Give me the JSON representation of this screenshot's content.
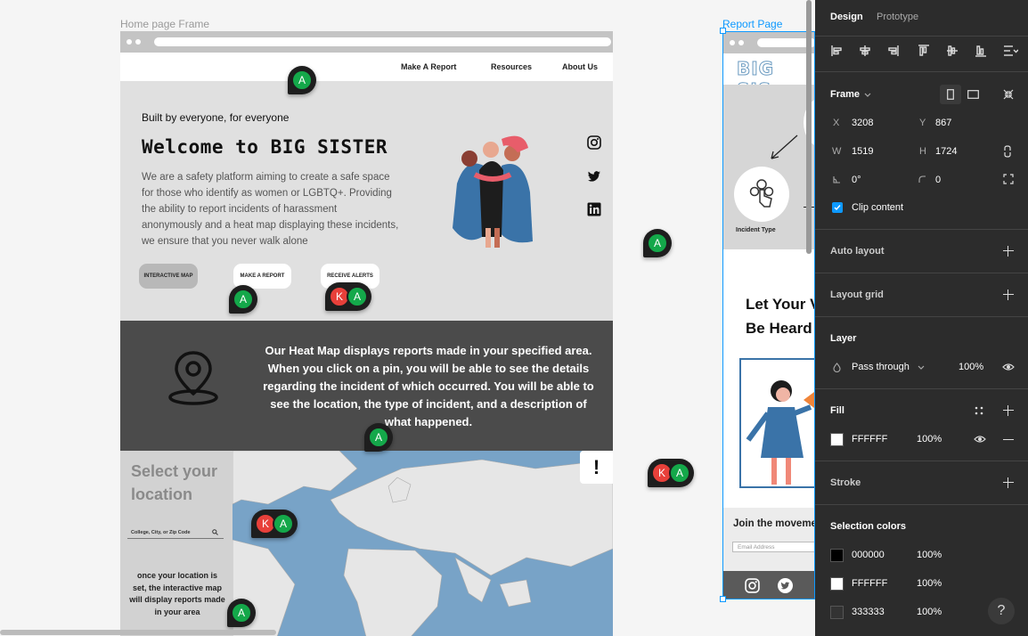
{
  "canvas": {
    "home_frame_label": "Home page Frame",
    "report_frame_label": "Report Page"
  },
  "home": {
    "nav": [
      "Make A Report",
      "Resources",
      "About Us"
    ],
    "hero": {
      "tagline": "Built by everyone, for everyone",
      "title": "Welcome to BIG SISTER",
      "description": "We are a safety platform aiming to create a safe space for those who identify as women or LGBTQ+. Providing the ability to report incidents of harassment anonymously and a heat map displaying these incidents, we ensure that you never walk alone",
      "buttons": [
        "INTERACTIVE MAP",
        "MAKE A REPORT",
        "RECEIVE ALERTS"
      ],
      "social_icons": [
        "instagram-icon",
        "twitter-icon",
        "linkedin-icon"
      ]
    },
    "heatmap": {
      "text": "Our Heat Map displays reports made in your specified area. When you click on a pin, you will be able to see the details regarding the incident of which occurred. You will be able to see the location, the type of incident, and a description of what happened."
    },
    "map": {
      "heading": "Select your location",
      "search_placeholder": "College, City, or Zip Code",
      "info": "once your location is set, the interactive map will display reports made in your area",
      "alert_glyph": "!"
    }
  },
  "report": {
    "logo": "BIG SIS",
    "incident_label": "Incident Type",
    "headline": "Let Your V Be Heard",
    "join_text": "Join the moveme",
    "email_placeholder": "Email Address"
  },
  "comments": {
    "initials_a": "A",
    "initials_k": "K"
  },
  "panel": {
    "tabs": [
      "Design",
      "Prototype"
    ],
    "frame": {
      "label": "Frame",
      "x_label": "X",
      "x": "3208",
      "y_label": "Y",
      "y": "867",
      "w_label": "W",
      "w": "1519",
      "h_label": "H",
      "h": "1724",
      "rotation": "0°",
      "radius": "0",
      "clip_content": "Clip content"
    },
    "auto_layout": "Auto layout",
    "layout_grid": "Layout grid",
    "layer": {
      "label": "Layer",
      "blend": "Pass through",
      "opacity": "100%"
    },
    "fill": {
      "label": "Fill",
      "hex": "FFFFFF",
      "opacity": "100%"
    },
    "stroke": "Stroke",
    "selection_colors": {
      "label": "Selection colors",
      "items": [
        {
          "hex": "000000",
          "opacity": "100%",
          "color": "#000000"
        },
        {
          "hex": "FFFFFF",
          "opacity": "100%",
          "color": "#FFFFFF"
        },
        {
          "hex": "333333",
          "opacity": "100%",
          "color": "#333333"
        }
      ]
    },
    "help": "?"
  },
  "colors": {
    "accent": "#0d99ff",
    "panel_bg": "#2c2c2c",
    "avatar_green": "#14a84a",
    "avatar_red": "#e8403a"
  }
}
